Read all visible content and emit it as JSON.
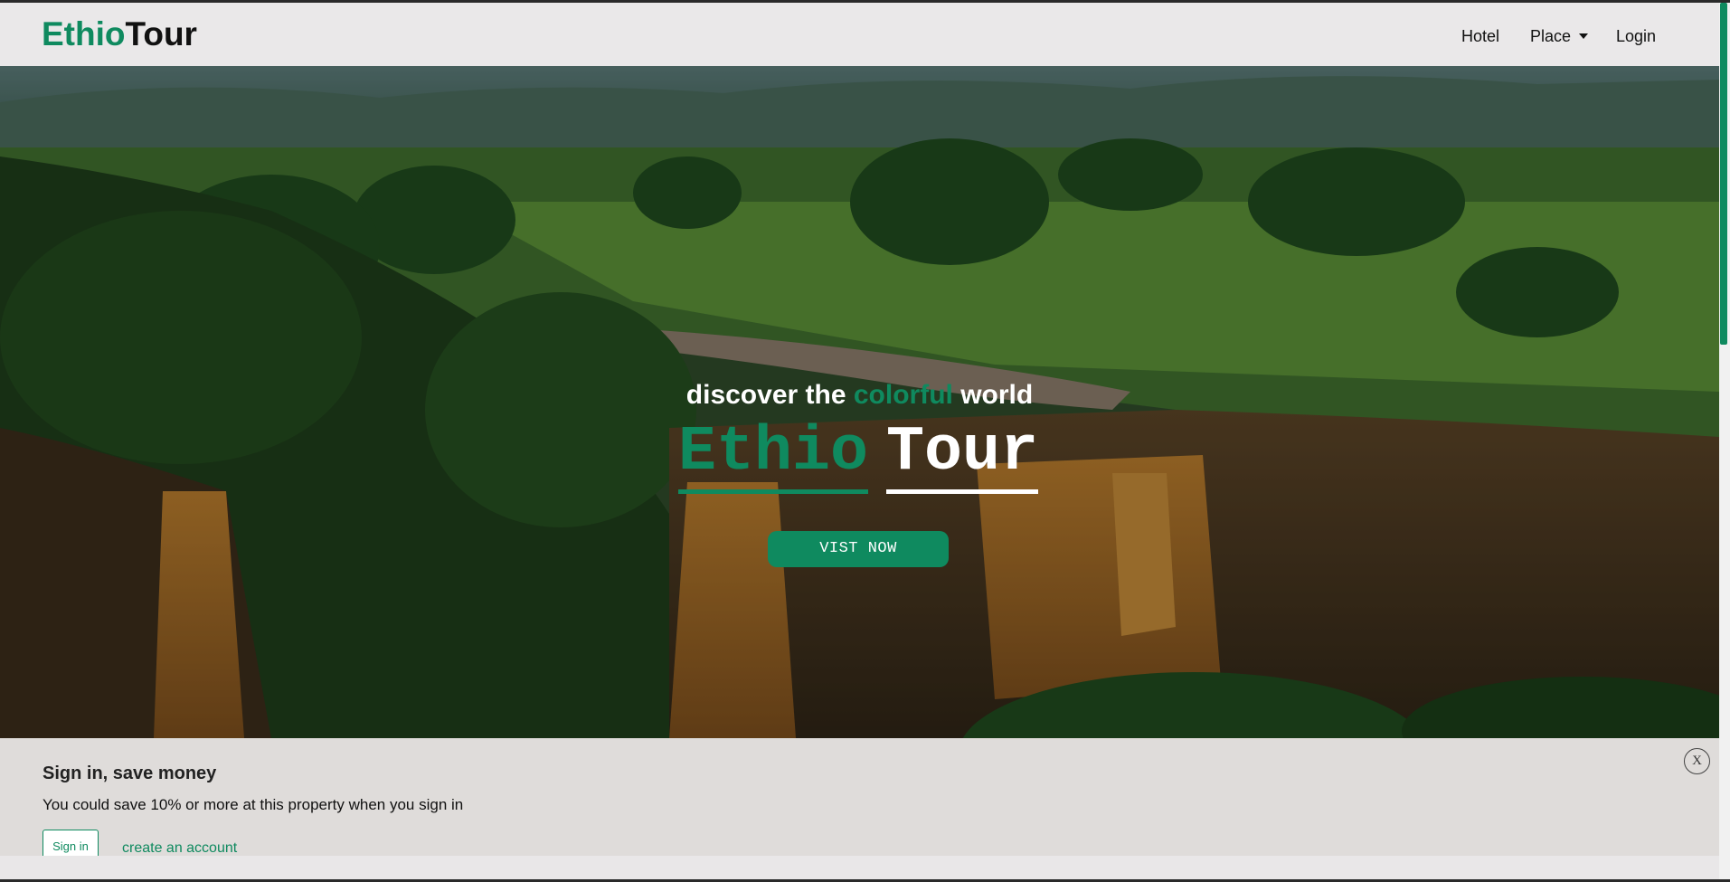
{
  "brand": {
    "part1": "Ethio",
    "part2": "Tour"
  },
  "nav": {
    "hotel": "Hotel",
    "place": "Place",
    "login": "Login"
  },
  "hero": {
    "tagline_pre": "discover the",
    "tagline_highlight": "colorful",
    "tagline_post": "world",
    "title_part1": "Ethio",
    "title_part2": "Tour",
    "cta": "VIST NOW"
  },
  "signin_banner": {
    "title": "Sign in, save money",
    "text": "You could save 10% or more at this property when you sign in",
    "signin_button": "Sign in",
    "create_link": "create an account",
    "close": "X"
  },
  "colors": {
    "brand_green": "#0f8a5f",
    "nav_bg": "#eae8e9",
    "banner_bg": "#dfdcda"
  },
  "icons": {
    "dropdown": "caret-down-icon",
    "close": "close-icon"
  }
}
